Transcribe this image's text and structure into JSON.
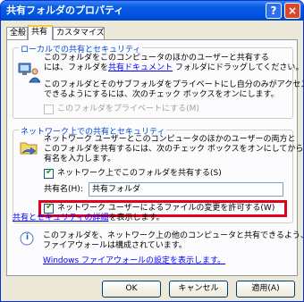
{
  "window": {
    "title": "共有フォルダのプロパティ",
    "help_glyph": "?",
    "close_glyph": "×"
  },
  "tabs": [
    {
      "label": "全般"
    },
    {
      "label": "共有"
    },
    {
      "label": "カスタマイズ"
    }
  ],
  "local_sharing": {
    "legend": "ローカルでの共有とセキュリティ",
    "desc_line1": "このフォルダをこのコンピュータのほかのユーザーと共有する",
    "desc_line2_pre": "には、フォルダを",
    "desc_line2_link": "共有ドキュメント",
    "desc_line2_post": " フォルダにドラッグしてください。",
    "private_line1": "このフォルダとそのサブフォルダをプライベートにし自分のみがアクセス",
    "private_line2": "できるようにするには、次のチェック ボックスをオンにします。",
    "private_checkbox_label": "このフォルダをプライベートにする(M)"
  },
  "network_sharing": {
    "legend": "ネットワーク上での共有とセキュリティ",
    "desc_line1": "ネットワーク ユーザーとこのコンピュータのほかのユーザーの両方と",
    "desc_line2": "このフォルダを共有するには、次のチェック ボックスをオンにしてから共",
    "desc_line3": "有名を入力します。",
    "share_checkbox_label": "ネットワーク上でこのフォルダを共有する(S)",
    "share_name_label": "共有名(H):",
    "share_name_value": "共有フォルダ",
    "allow_change_label": "ネットワーク ユーザーによるファイルの変更を許可する(W)",
    "details_link": "共有とセキュリティの詳細",
    "details_suffix": "を表示します。",
    "check_glyph": "✔"
  },
  "info": {
    "glyph": "i",
    "line1": "このフォルダを、ネットワーク上の他のコンピュータと共有できるよう、Windows",
    "line2": "ファイアウォールは構成されています。",
    "firewall_link": "Windows ファイアウォールの設定を表示します。"
  },
  "buttons": {
    "ok": "OK",
    "cancel": "キャンセル",
    "apply": "適用(A)"
  },
  "colors": {
    "titlebar": "#0054e3",
    "highlight_box": "#e0001b",
    "link": "#0000ff",
    "group_legend": "#0046d5"
  }
}
